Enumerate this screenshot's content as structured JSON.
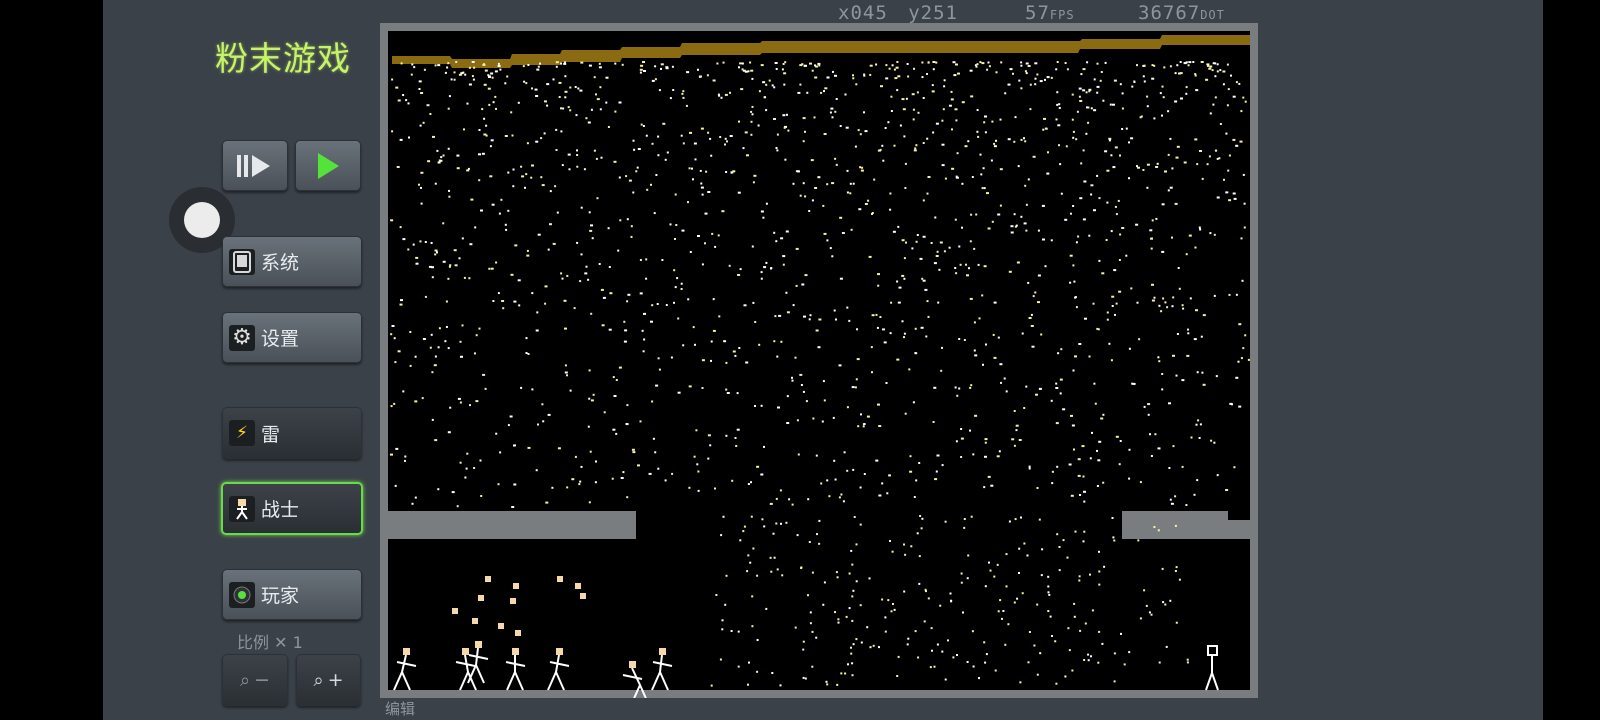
{
  "app": {
    "title": "粉末游戏",
    "edit_label": "编辑",
    "scale_label": "比例 ✕ 1"
  },
  "status": {
    "x": "x045",
    "y": "y251",
    "fps_value": "57",
    "fps_unit": "FPS",
    "dot_value": "36767",
    "dot_unit": "DOT"
  },
  "buttons": {
    "step": {
      "icon": "step-forward-icon"
    },
    "play": {
      "icon": "play-icon"
    },
    "system": {
      "label": "系统",
      "icon": "tablet-icon"
    },
    "settings": {
      "label": "设置",
      "icon": "gear-icon"
    },
    "thunder": {
      "label": "雷",
      "icon": "lightning-icon"
    },
    "fighter": {
      "label": "战士",
      "icon": "fighter-icon"
    },
    "player": {
      "label": "玩家",
      "icon": "player-icon"
    },
    "zoom_out": {
      "label": "−",
      "icon": "magnifier-icon"
    },
    "zoom_in": {
      "label": "+",
      "icon": "magnifier-icon"
    }
  },
  "colors": {
    "panel": "#3b4148",
    "accent_green": "#c6f36a",
    "selected_border": "#6ad94a",
    "powder_top": "#8b6b12",
    "spark": "#f7f3a0",
    "wall": "#7a7d80",
    "fighter": "#ffffff"
  }
}
